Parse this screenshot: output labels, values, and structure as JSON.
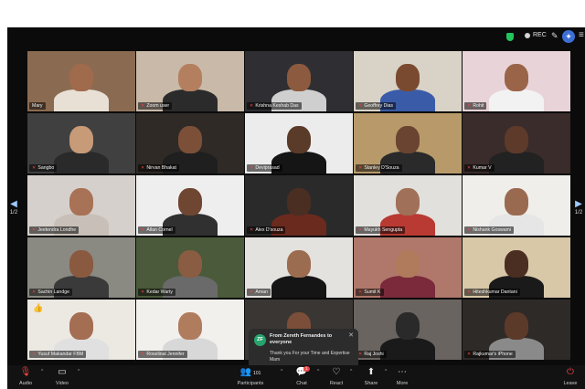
{
  "topbar": {
    "rec_label": "REC"
  },
  "nav": {
    "left_page": "1/2",
    "right_page": "1/2"
  },
  "participants": [
    {
      "name": "Mary",
      "bg": "#8a6b52",
      "skin": "#a06a4c",
      "shirt": "#e8e0d4"
    },
    {
      "name": "Zoom user",
      "bg": "#c9b9a8",
      "skin": "#b47f5f",
      "shirt": "#2b2b2b"
    },
    {
      "name": "Krishna Keshab Das",
      "bg": "#2f2f33",
      "skin": "#8c5a3e",
      "shirt": "#cfcfcf"
    },
    {
      "name": "Geoffrey Dias",
      "bg": "#d9d2c6",
      "skin": "#7a4a30",
      "shirt": "#3a5ca8"
    },
    {
      "name": "Rohit",
      "bg": "#e8d3d8",
      "skin": "#9a6448",
      "shirt": "#f2f2f2"
    },
    {
      "name": "Sangbo",
      "bg": "#404040",
      "skin": "#c79a78",
      "shirt": "#2a2a2a"
    },
    {
      "name": "Nirvan Bhakat",
      "bg": "#2f2a26",
      "skin": "#7c5038",
      "shirt": "#1f1f1f"
    },
    {
      "name": "Deviprasad",
      "bg": "#ececec",
      "skin": "#5a3a28",
      "shirt": "#151515"
    },
    {
      "name": "Stanley D'Souza",
      "bg": "#b89a6a",
      "skin": "#6a4430",
      "shirt": "#2a2a2a"
    },
    {
      "name": "Kumar V",
      "bg": "#3a2c2a",
      "skin": "#5e3a2a",
      "shirt": "#222222"
    },
    {
      "name": "Jeetendra Londhe",
      "bg": "#d6d0cc",
      "skin": "#a87256",
      "shirt": "#c8c0b8"
    },
    {
      "name": "Allan Cornel",
      "bg": "#eeeeee",
      "skin": "#6e4632",
      "shirt": "#303030"
    },
    {
      "name": "Alex D'souza",
      "bg": "#2a2a2a",
      "skin": "#4a2e22",
      "shirt": "#6a2a1e"
    },
    {
      "name": "Mayukh Sengupta",
      "bg": "#e2e0dc",
      "skin": "#a07058",
      "shirt": "#b83a32"
    },
    {
      "name": "Nishank Goswami",
      "bg": "#f0eeea",
      "skin": "#9a6a50",
      "shirt": "#e6e6e6"
    },
    {
      "name": "Sachin Landge",
      "bg": "#8a8a82",
      "skin": "#8a5a40",
      "shirt": "#3a3a3a"
    },
    {
      "name": "Kedar Warty",
      "bg": "#4a5a3a",
      "skin": "#8a5c42",
      "shirt": "#6a6a6a"
    },
    {
      "name": "Aman",
      "bg": "#e4e2de",
      "skin": "#9c6c50",
      "shirt": "#151515"
    },
    {
      "name": "Sumit K",
      "bg": "#b0786a",
      "skin": "#b07a5c",
      "shirt": "#7a2a3a"
    },
    {
      "name": "Hiteshkumar Dantani",
      "bg": "#d8c8a8",
      "skin": "#4a2e22",
      "shirt": "#1a1a1a"
    },
    {
      "name": "Yusuf Makandar FBM",
      "bg": "#ece8e2",
      "skin": "#a46e52",
      "shirt": "#e0e0e0"
    },
    {
      "name": "Roselinal Jennifer",
      "bg": "#f2f0ec",
      "skin": "#b07c5e",
      "shirt": "#d8d8d8"
    },
    {
      "name": "",
      "bg": "#3a3634",
      "skin": "#7a4e38",
      "shirt": "#202020"
    },
    {
      "name": "Raj Joshi",
      "bg": "#6a6460",
      "skin": "#2a2a2a",
      "shirt": "#1a1a1a"
    },
    {
      "name": "Rajkumar's iPhone",
      "bg": "#2e2a28",
      "skin": "#5c3a2a",
      "shirt": "#8a8a8a"
    }
  ],
  "chat_popup": {
    "avatar_initials": "ZF",
    "from": "From Zereth Fernandes to everyone",
    "message": "Thank you For your Time and Expertise Mam"
  },
  "toolbar": {
    "audio": "Audio",
    "video": "Video",
    "participants": "Participants",
    "participants_count": "101",
    "chat": "Chat",
    "chat_badge": "1",
    "react": "React",
    "share": "Share",
    "more": "More",
    "leave": "Leave"
  }
}
